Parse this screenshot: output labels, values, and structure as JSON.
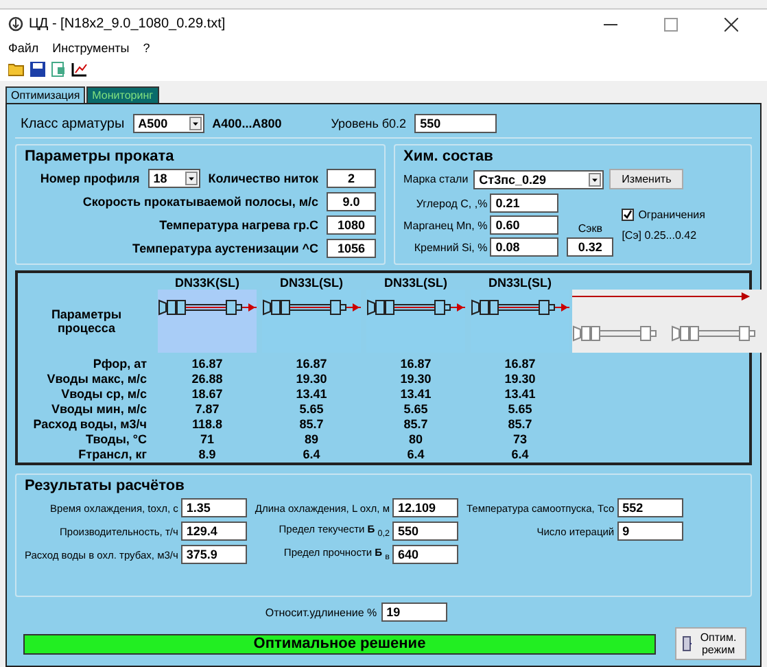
{
  "window": {
    "title": "ЦД - [N18x2_9.0_1080_0.29.txt]"
  },
  "menu": [
    "Файл",
    "Инструменты",
    "?"
  ],
  "tabs": [
    {
      "label": "Оптимизация",
      "selected": true
    },
    {
      "label": "Мониторинг",
      "selected": false
    }
  ],
  "armature": {
    "label": "Класс арматуры",
    "value": "А500",
    "range": "А400...А800",
    "level_label": "Уровень  б0.2",
    "level_value": "550"
  },
  "rolling": {
    "title": "Параметры проката",
    "profile_label": "Номер профиля",
    "profile_value": "18",
    "strands_label": "Количество ниток",
    "strands_value": "2",
    "fields": [
      {
        "label": "Скорость прокатываемой полосы, м/с",
        "value": "9.0"
      },
      {
        "label": "Температура нагрева  гр.С",
        "value": "1080"
      },
      {
        "label": "Температура аустенизации ^С",
        "value": "1056"
      }
    ]
  },
  "chemistry": {
    "title": "Хим. состав",
    "grade_label": "Марка стали",
    "grade_value": "Ст3пс_0.29",
    "change_button": "Изменить",
    "fields": [
      {
        "label": "Углерод С,  ,%",
        "value": "0.21"
      },
      {
        "label": "Марганец Mn, %",
        "value": "0.60"
      },
      {
        "label": "Кремний Si, %",
        "value": "0.08"
      }
    ],
    "ceq_label": "Сэкв",
    "ceq_value": "0.32",
    "limits": {
      "label": "Ограничения",
      "checked": true
    },
    "range": "[Сэ] 0.25...0.42"
  },
  "process": {
    "header": "Параметры процесса",
    "columns": [
      {
        "name": "DN33K(SL)",
        "selected": true
      },
      {
        "name": "DN33L(SL)",
        "selected": false
      },
      {
        "name": "DN33L(SL)",
        "selected": false
      },
      {
        "name": "DN33L(SL)",
        "selected": false
      }
    ],
    "rows": [
      {
        "label": "Рфор,   ат",
        "values": [
          "16.87",
          "16.87",
          "16.87",
          "16.87"
        ]
      },
      {
        "label": "Vводы макс, м/с",
        "values": [
          "26.88",
          "19.30",
          "19.30",
          "19.30"
        ]
      },
      {
        "label": "Vводы ср, м/с",
        "values": [
          "18.67",
          "13.41",
          "13.41",
          "13.41"
        ]
      },
      {
        "label": "Vводы мин, м/с",
        "values": [
          "7.87",
          "5.65",
          "5.65",
          "5.65"
        ]
      },
      {
        "label": "Расход воды, м3/ч",
        "values": [
          "118.8",
          "85.7",
          "85.7",
          "85.7"
        ]
      },
      {
        "label": "Тводы,   °С",
        "values": [
          "71",
          "89",
          "80",
          "73"
        ]
      },
      {
        "label": "Fтрансл,  кг",
        "values": [
          "8.9",
          "6.4",
          "6.4",
          "6.4"
        ]
      }
    ]
  },
  "results": {
    "title": "Результаты расчётов",
    "col1": [
      {
        "label": "Время охлаждения, tохл, с",
        "value": "1.35"
      },
      {
        "label": "Производительность, т/ч",
        "value": "129.4"
      },
      {
        "label": "Расход воды в охл. трубах, м3/ч",
        "value": "375.9"
      }
    ],
    "col2": [
      {
        "label": "Длина охлаждения, L охл, м",
        "value": "12.109"
      },
      {
        "label": "Предел текучести **Б** $_{0,2}$",
        "value": "550"
      },
      {
        "label": "Предел прочности **Б** $_{в}$",
        "value": "640"
      }
    ],
    "col3": [
      {
        "label": "Температура самоотпуска, Тсо",
        "value": "552"
      },
      {
        "label": "Число итераций",
        "value": "9"
      }
    ],
    "elongation_label": "Относит.удлинение  %",
    "elongation_value": "19"
  },
  "status": {
    "text": "Оптимальное решение",
    "ok": true
  },
  "optimize_button": "Оптим. режим"
}
